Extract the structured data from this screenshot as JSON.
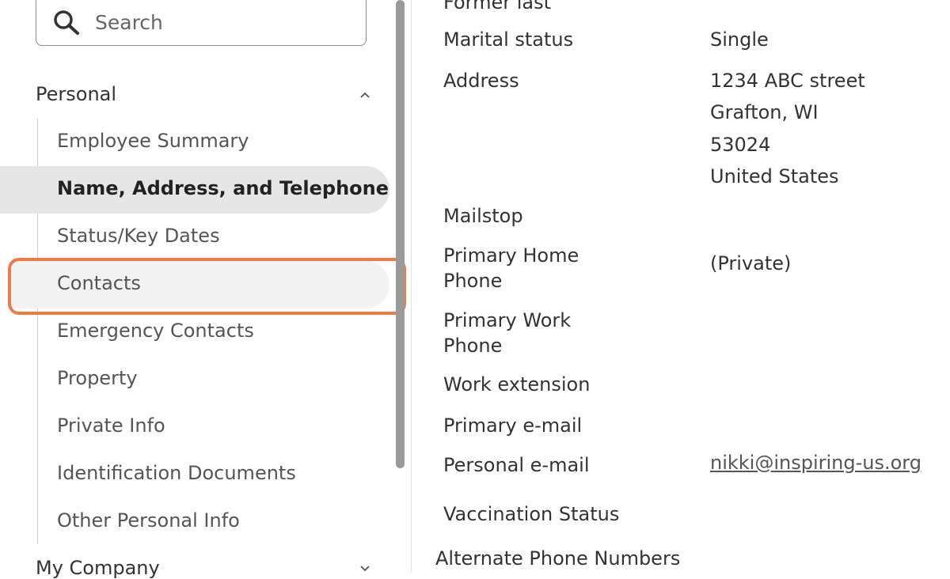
{
  "search": {
    "placeholder": "Search"
  },
  "sidebar": {
    "sections": [
      {
        "label": "Personal"
      },
      {
        "label": "My Company"
      }
    ],
    "items": [
      {
        "label": "Employee Summary"
      },
      {
        "label": "Name, Address, and Telephone"
      },
      {
        "label": "Status/Key Dates"
      },
      {
        "label": "Contacts"
      },
      {
        "label": "Emergency Contacts"
      },
      {
        "label": "Property"
      },
      {
        "label": "Private Info"
      },
      {
        "label": "Identification Documents"
      },
      {
        "label": "Other Personal Info"
      }
    ]
  },
  "details": {
    "former_last_label": "Former last",
    "marital_status_label": "Marital status",
    "marital_status_value": "Single",
    "address_label": "Address",
    "address_line1": "1234 ABC street",
    "address_line2": "Grafton, WI",
    "address_line3": "53024",
    "address_line4": "United States",
    "mailstop_label": "Mailstop",
    "home_phone_label_1": "Primary Home",
    "home_phone_label_2": "Phone",
    "home_phone_value": "(Private)",
    "work_phone_label_1": "Primary Work",
    "work_phone_label_2": "Phone",
    "work_extension_label": "Work extension",
    "primary_email_label": "Primary e-mail",
    "personal_email_label": "Personal e-mail",
    "personal_email_value": "nikki@inspiring-us.org",
    "vaccination_label": "Vaccination Status",
    "alt_phone_label": "Alternate Phone Numbers"
  },
  "colors": {
    "highlight": "#f07a46",
    "active_bg": "#e6e6e6"
  }
}
